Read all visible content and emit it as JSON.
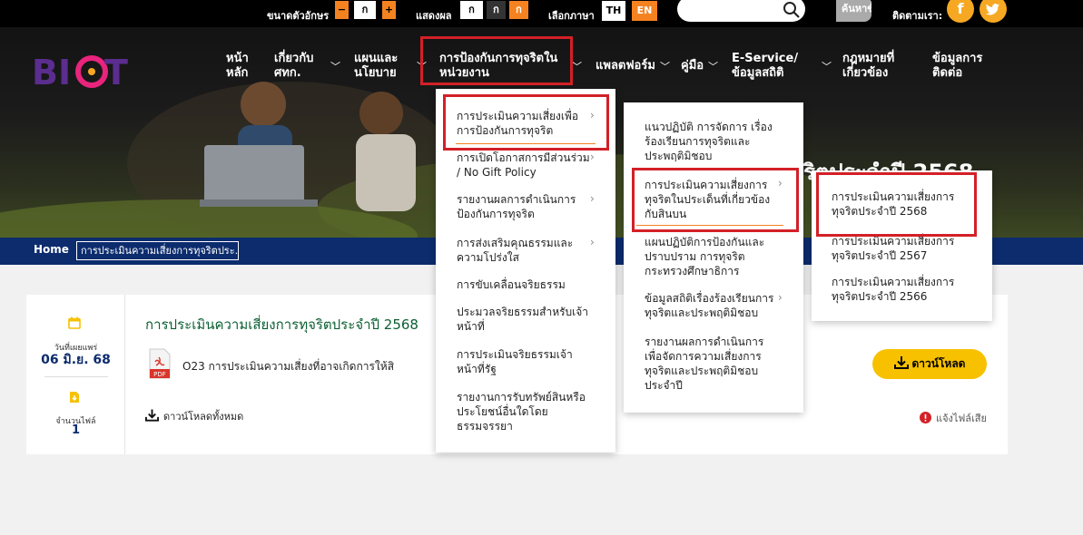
{
  "topbar": {
    "font_size_label": "ขนาดตัวอักษร",
    "font_minus": "−",
    "font_normal": "ก",
    "font_plus": "+",
    "display_label": "แสดงผล",
    "display_a": "ก",
    "display_b": "ก",
    "display_c": "ก",
    "language_label": "เลือกภาษา",
    "lang_th": "TH",
    "lang_en": "EN",
    "search_placeholder": "",
    "advanced_search": "ค้นหาขั้นสูง",
    "follow_label": "ติดตามเรา:",
    "facebook": "f",
    "twitter": "t"
  },
  "nav": {
    "home": "หน้าหลัก",
    "about": "เกี่ยวกับ ศทก.",
    "plan": "แผนและนโยบาย",
    "anticorruption": "การป้องกันการทุจริตในหน่วยงาน",
    "platform": "แพลตฟอร์ม",
    "manual": "คู่มือ",
    "eservice": "E-Service/ข้อมูลสถิติ",
    "law": "กฎหมายที่เกี่ยวข้อง",
    "contact": "ข้อมูลการติดต่อ"
  },
  "hero": {
    "title": "ริตประจำปี 2568"
  },
  "breadcrumb": {
    "home": "Home",
    "current": "การประเมินความเสี่ยงการทุจริตประ..."
  },
  "menu1": {
    "items": [
      "การประเมินความเสี่ยงเพื่อการป้องกันการทุจริต",
      "การเปิดโอกาสการมีส่วนร่วม / No Gift Policy",
      "รายงานผลการดำเนินการป้องกันการทุจริต",
      "การส่งเสริมคุณธรรมและความโปร่งใส",
      "การขับเคลื่อนจริยธรรม",
      "ประมวลจริยธรรมสำหรับเจ้าหน้าที่",
      "การประเมินจริยธรรมเจ้าหน้าที่รัฐ",
      "รายงานการรับทรัพย์สินหรือประโยชน์อื่นใดโดยธรรมจรรยา"
    ]
  },
  "menu2": {
    "items": [
      "แนวปฏิบัติ การจัดการ เรื่องร้องเรียนการทุจริตและประพฤติมิชอบ",
      "การประเมินความเสี่ยงการทุจริตในประเด็นที่เกี่ยวข้องกับสินบน",
      "แผนปฏิบัติการป้องกันและปราบปราม การทุจริต กระทรวงศึกษาธิการ",
      "ข้อมูลสถิติเรื่องร้องเรียนการทุจริตและประพฤติมิชอบ",
      "รายงานผลการดำเนินการเพื่อจัดการความเสี่ยงการทุจริตและประพฤติมิชอบประจำปี"
    ]
  },
  "menu3": {
    "items": [
      "การประเมินความเสี่ยงการทุจริตประจำปี 2568",
      "การประเมินความเสี่ยงการทุจริตประจำปี 2567",
      "การประเมินความเสี่ยงการทุจริตประจำปี 2566"
    ]
  },
  "card": {
    "published_label": "วันที่เผยแพร่",
    "published_date": "06 มิ.ย. 68",
    "file_count_label": "จำนวนไฟล์",
    "file_count": "1",
    "title": "การประเมินความเสี่ยงการทุจริตประจำปี 2568",
    "pdf_label": "PDF",
    "file_name": "O23 การประเมินความเสี่ยงที่อาจเกิดการให้สิ",
    "download": "ดาวน์โหลด",
    "download_all": "ดาวน์โหลดทั้งหมด",
    "report_broken": "แจ้งไฟล์เสีย"
  },
  "colors": {
    "accent_orange": "#f58220",
    "crumb_navy": "#0c2c6e",
    "title_green": "#0b5f31",
    "download_yellow": "#f7c100",
    "highlight_red": "#d32027"
  }
}
